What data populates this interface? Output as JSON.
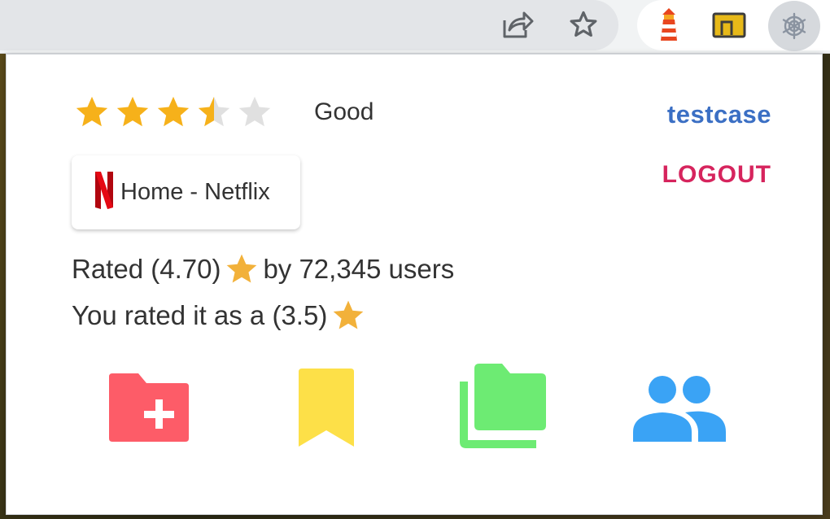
{
  "browser": {
    "icons": [
      "share-icon",
      "bookmark-star-icon",
      "lighthouse-extension-icon",
      "folder-extension-icon",
      "snowflake-extension-icon"
    ]
  },
  "popup": {
    "rating": {
      "stars_value": 3.5,
      "stars_max": 5,
      "word": "Good"
    },
    "user": {
      "username": "testcase",
      "logout_label": "LOGOUT"
    },
    "site": {
      "icon": "netflix-logo-icon",
      "name": "Home - Netflix"
    },
    "stats": {
      "rated_prefix": "Rated (4.70)",
      "rated_suffix": "by 72,345 users",
      "you_prefix": "You rated it as a (3.5)"
    },
    "actions": [
      {
        "icon": "folder-add-icon",
        "color": "#fd5c68"
      },
      {
        "icon": "bookmark-icon",
        "color": "#fde048"
      },
      {
        "icon": "collections-icon",
        "color": "#6deb73"
      },
      {
        "icon": "friends-icon",
        "color": "#3aa3f5"
      }
    ],
    "colors": {
      "star_filled": "#f6b11a",
      "star_empty": "#e0e0e0",
      "username": "#3b6fc4",
      "logout": "#d6245d"
    }
  }
}
